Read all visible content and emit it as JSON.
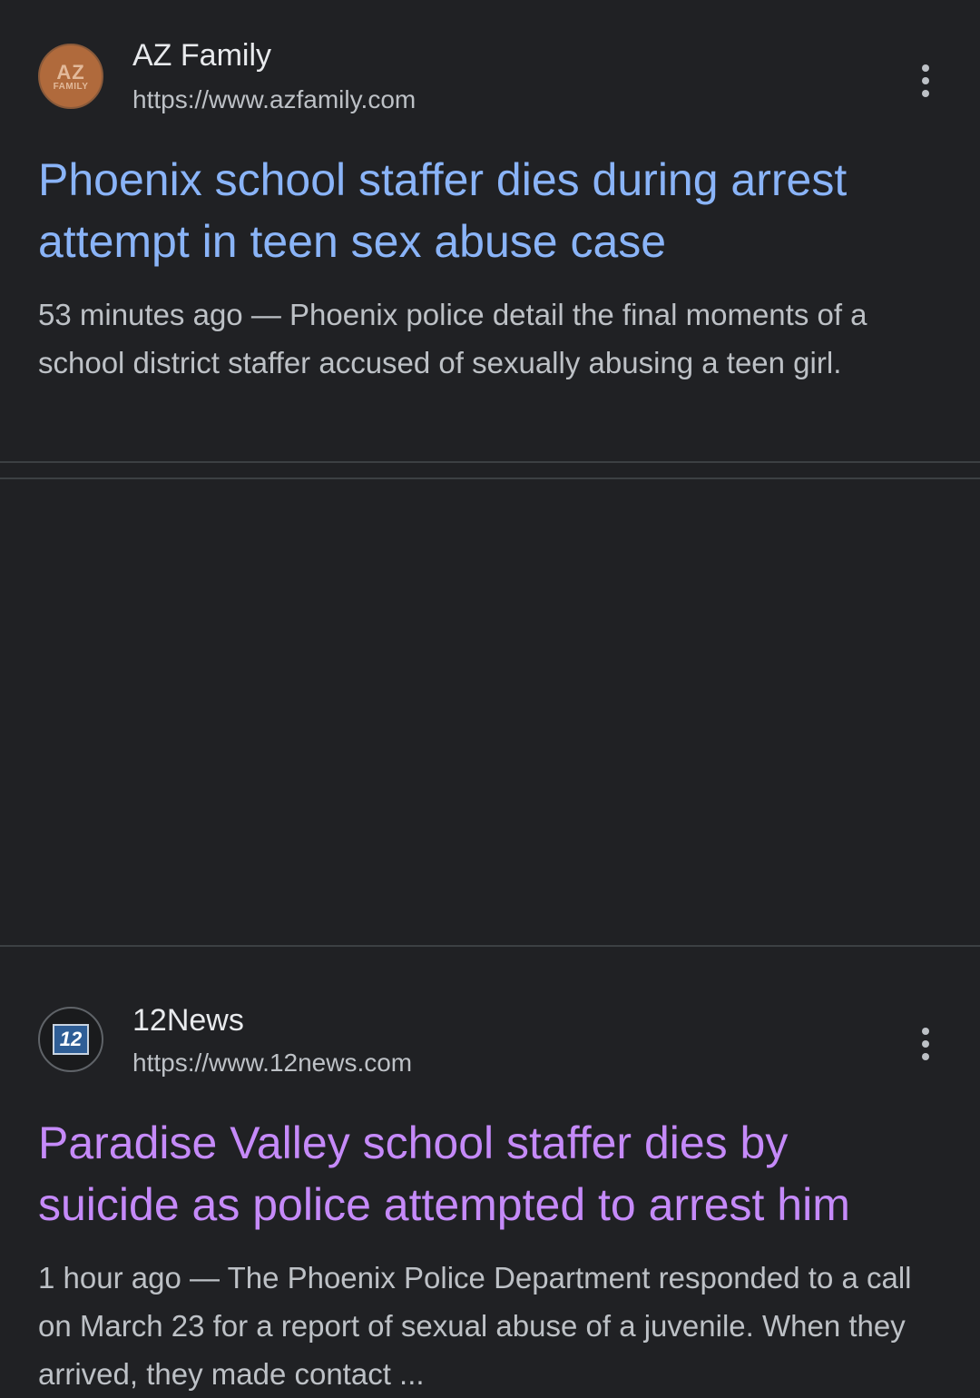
{
  "results": [
    {
      "site_name": "AZ Family",
      "url": "https://www.azfamily.com",
      "favicon_text_main": "AZ",
      "favicon_text_sub": "FAMILY",
      "title": "Phoenix school staffer dies during arrest attempt in teen sex abuse case",
      "snippet_time": "53 minutes ago",
      "snippet_sep": " — ",
      "snippet_text": "Phoenix police detail the final moments of a school district staffer accused of sexually abusing a teen girl.",
      "title_color": "#8ab4f8",
      "visited": false
    },
    {
      "site_name": "12News",
      "url": "https://www.12news.com",
      "favicon_text_main": "12",
      "title": "Paradise Valley school staffer dies by suicide as police attempted to arrest him",
      "snippet_time": "1 hour ago",
      "snippet_sep": " — ",
      "snippet_text": "The Phoenix Police Department responded to a call on March 23 for a report of sexual abuse of a juvenile. When they arrived, they made contact ...",
      "title_color": "#c58af9",
      "visited": true
    }
  ],
  "icons": {
    "more_options": "more-vert-icon"
  },
  "colors": {
    "background": "#202124",
    "link_unvisited": "#8ab4f8",
    "link_visited": "#c58af9",
    "snippet_text": "#bdc1c6"
  }
}
